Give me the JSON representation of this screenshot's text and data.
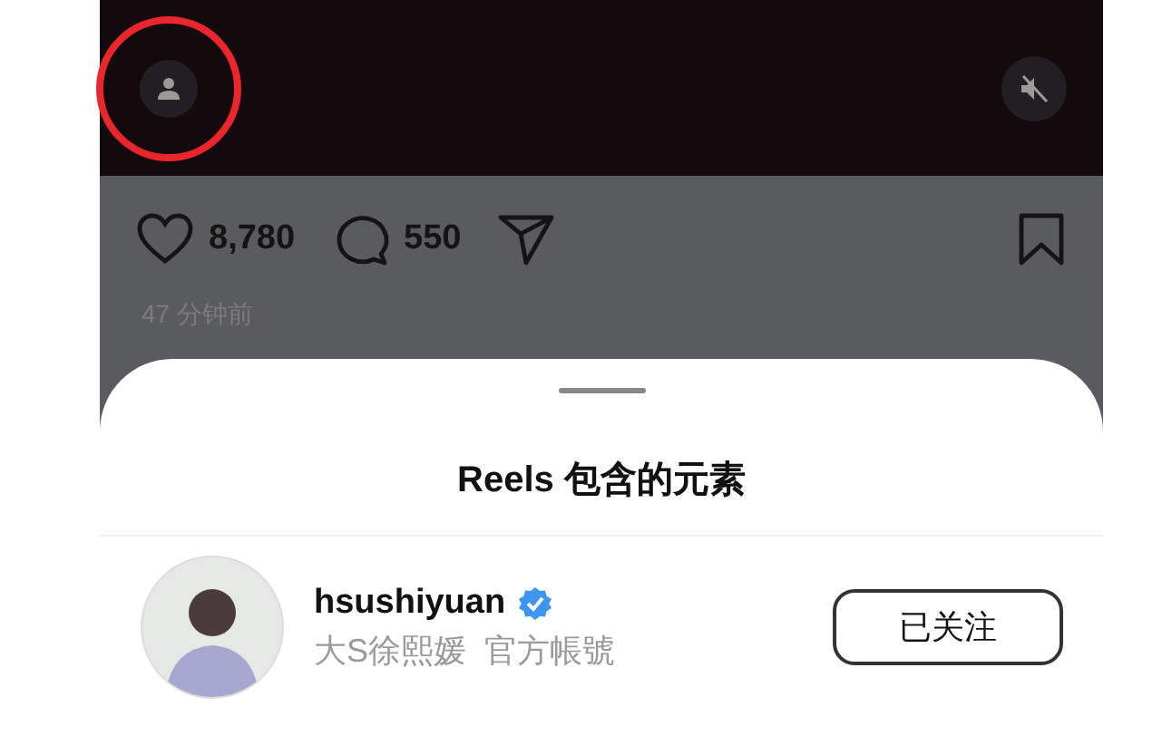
{
  "post": {
    "likes": "8,780",
    "comments": "550",
    "time": "47 分钟前"
  },
  "sheet": {
    "title": "Reels 包含的元素",
    "accounts": [
      {
        "username": "hsushiyuan",
        "verified": true,
        "subtitle": "大S徐熙媛  官方帳號",
        "button": "已关注"
      }
    ]
  }
}
